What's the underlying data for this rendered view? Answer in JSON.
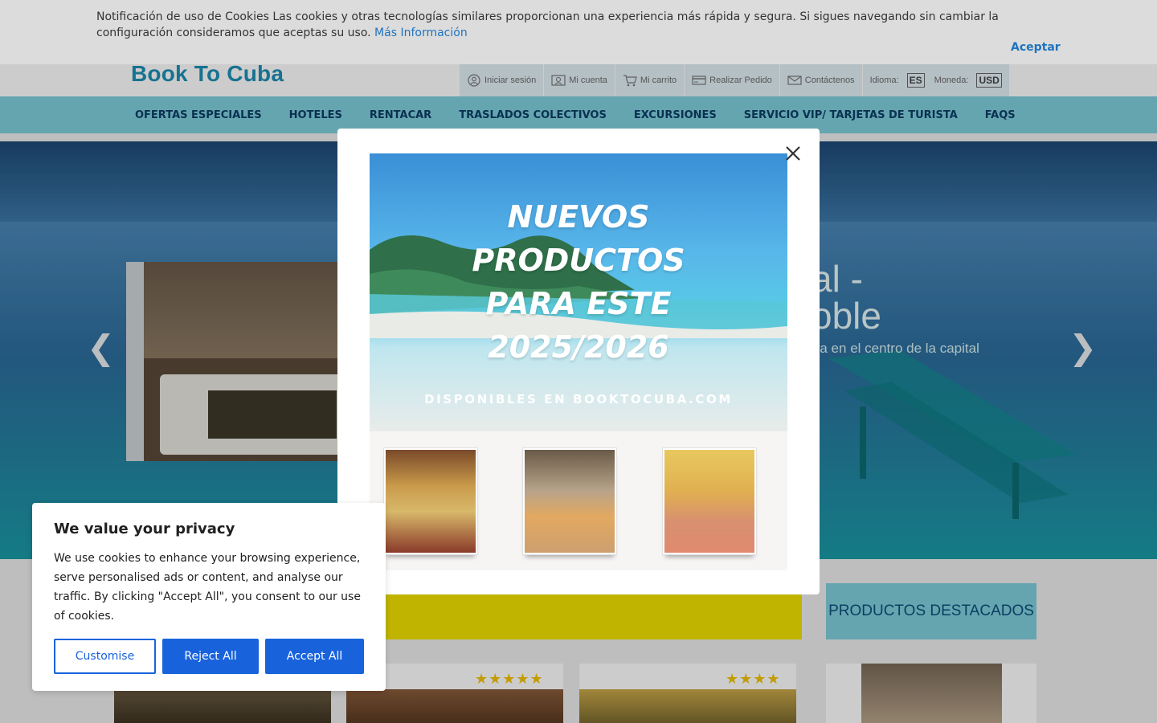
{
  "header": {
    "brand": "Book To Cuba",
    "links": {
      "login": "Iniciar sesión",
      "account": "Mi cuenta",
      "cart": "Mi carrito",
      "order": "Realizar Pedido",
      "contact": "Contáctenos",
      "language_label": "Idioma:",
      "language_value": "ES",
      "currency_label": "Moneda:",
      "currency_value": "USD"
    }
  },
  "nav": {
    "items": [
      "OFERTAS ESPECIALES",
      "HOTELES",
      "RENTACAR",
      "TRASLADOS COLECTIVOS",
      "EXCURSIONES",
      "SERVICIO VIP/ TARJETAS DE TURISTA",
      "FAQS"
    ]
  },
  "hero": {
    "title_line1": "al -",
    "title_line2": "oble",
    "subtitle": "tra en el centro de la capital",
    "prev_icon": "chevron-left-icon",
    "next_icon": "chevron-right-icon"
  },
  "sections": {
    "featured_label": "PRODUCTOS DESTACADOS",
    "stars_a": "★★★★★",
    "stars_b": "★★★★"
  },
  "cookie_bar": {
    "text": "Notificación de uso de Cookies Las cookies y otras tecnologías similares proporcionan una experiencia más rápida y segura. Si sigues navegando sin cambiar la configuración consideramos que aceptas su uso.",
    "more_link": "Más Información",
    "accept": "Aceptar"
  },
  "promo_modal": {
    "headline": [
      "NUEVOS",
      "PRODUCTOS",
      "PARA ESTE",
      "2025/2026"
    ],
    "available": "DISPONIBLES EN BOOKTOCUBA.COM",
    "close_icon": "close-icon"
  },
  "privacy": {
    "title": "We value your privacy",
    "body": "We use cookies to enhance your browsing experience, serve personalised ads or content, and analyse our traffic. By clicking \"Accept All\", you consent to our use of cookies.",
    "customise": "Customise",
    "reject": "Reject All",
    "accept": "Accept All"
  },
  "colors": {
    "brand": "#1f8fb6",
    "nav_bg": "#7fcfdc",
    "link": "#1e73be",
    "primary_button": "#1863dc",
    "promo_yellow": "#f2e100"
  }
}
